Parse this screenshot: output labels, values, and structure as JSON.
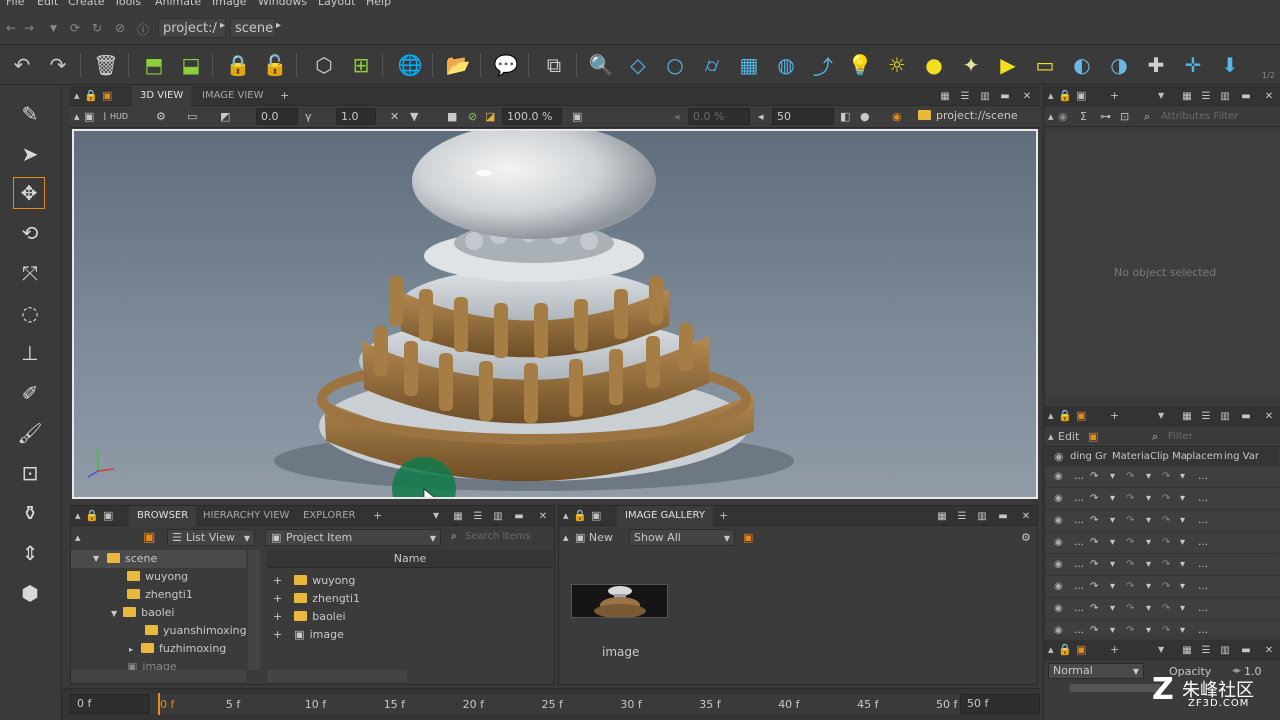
{
  "menu": [
    "File",
    "Edit",
    "Create",
    "Tools",
    "Animate",
    "Image",
    "Windows",
    "Layout",
    "Help"
  ],
  "address": {
    "crumbs": [
      "project:/",
      "scene"
    ]
  },
  "toolbar": {
    "version_text": "1/2"
  },
  "viewport_panel": {
    "tabs": [
      "3D VIEW",
      "IMAGE VIEW"
    ],
    "hud_label": "HUD",
    "field_a": "0.0",
    "field_b": "1.0",
    "zoom": "100.0 %",
    "field_c": "0.0 %",
    "field_d": "50",
    "path": "project://scene"
  },
  "right_top": {
    "filter_placeholder": "Attributes Filter",
    "empty_text": "No object selected"
  },
  "right_mid": {
    "edit_label": "Edit",
    "filter_placeholder": "Filter",
    "columns": [
      "ding Gr",
      "Materia",
      "Clip Ma",
      "placem",
      "ing Var"
    ]
  },
  "right_bottom": {
    "blend_mode": "Normal",
    "opacity_label": "Opacity",
    "opacity_value": "1.0"
  },
  "browser": {
    "tabs": [
      "BROWSER",
      "HIERARCHY VIEW",
      "EXPLORER"
    ],
    "view_mode": "List View",
    "item_type": "Project Item",
    "search_placeholder": "Search Items",
    "tree": [
      "scene",
      "wuyong",
      "zhengti1",
      "baolei",
      "yuanshimoxing",
      "fuzhimoxing",
      "image"
    ],
    "list_header": "Name",
    "list_items": [
      "wuyong",
      "zhengti1",
      "baolei",
      "image"
    ]
  },
  "gallery": {
    "tab": "IMAGE GALLERY",
    "new_label": "New",
    "show_filter": "Show All",
    "thumb_label": "image"
  },
  "timeline": {
    "start_frame": "0 f",
    "end_frame": "50 f",
    "ticks": [
      "0 f",
      "5 f",
      "10 f",
      "15 f",
      "20 f",
      "25 f",
      "30 f",
      "35 f",
      "40 f",
      "45 f",
      "50 f"
    ]
  },
  "watermark": {
    "brand": "朱峰社区",
    "url": "ZF3D.COM"
  }
}
